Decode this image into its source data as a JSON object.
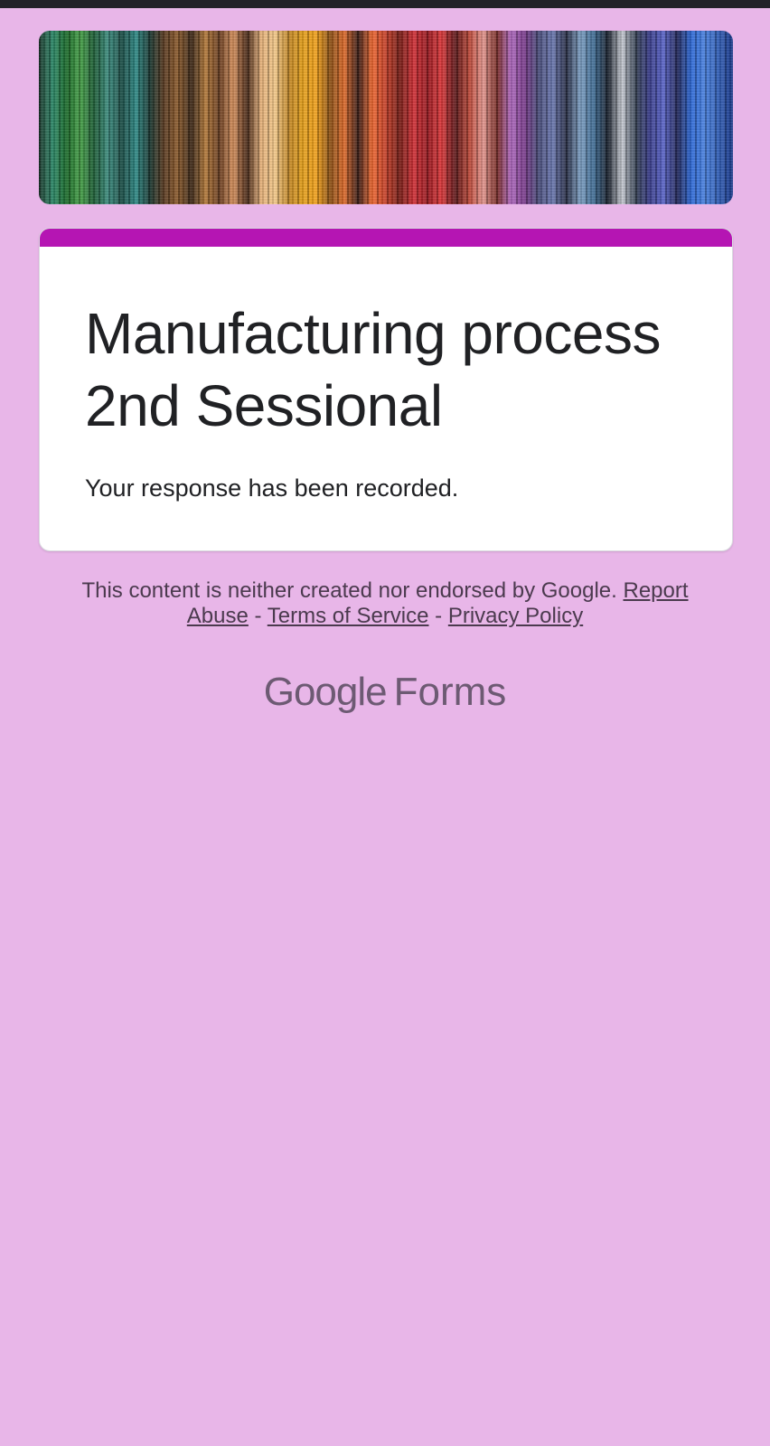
{
  "theme": {
    "background": "#e8b6e8",
    "accent": "#b515b3",
    "card_background": "#ffffff"
  },
  "header": {
    "banner_image": "colorful-yarn-strands-banner"
  },
  "form": {
    "title": "Manufacturing process 2nd Sessional",
    "confirmation": "Your response has been recorded."
  },
  "footer": {
    "disclaimer": "This content is neither created nor endorsed by Google.",
    "report_abuse_label": "Report Abuse",
    "separator": "-",
    "terms_label": "Terms of Service",
    "privacy_label": "Privacy Policy"
  },
  "brand": {
    "google": "Google",
    "forms": "Forms"
  }
}
